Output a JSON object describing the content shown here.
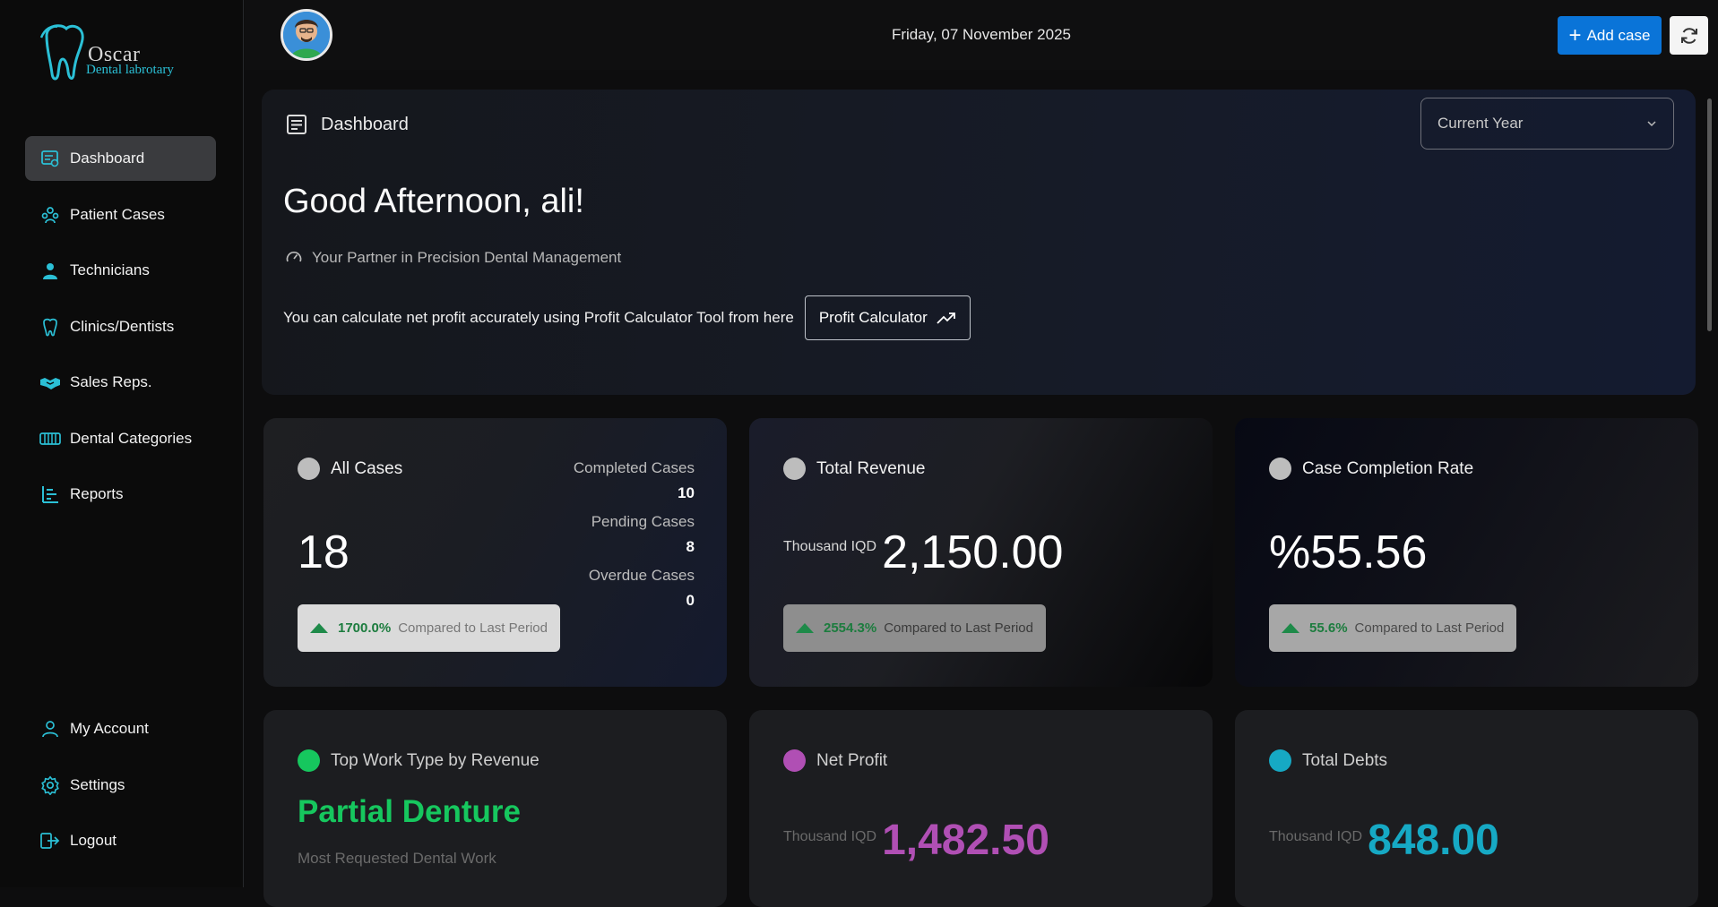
{
  "brand": {
    "name": "Oscar",
    "tagline": "Dental labrotary"
  },
  "sidebar": {
    "items": [
      {
        "label": "Dashboard",
        "icon": "dashboard-icon",
        "active": true
      },
      {
        "label": "Patient Cases",
        "icon": "patients-icon",
        "active": false
      },
      {
        "label": "Technicians",
        "icon": "technician-icon",
        "active": false
      },
      {
        "label": "Clinics/Dentists",
        "icon": "tooth-icon",
        "active": false
      },
      {
        "label": "Sales Reps.",
        "icon": "handshake-icon",
        "active": false
      },
      {
        "label": "Dental Categories",
        "icon": "categories-icon",
        "active": false
      },
      {
        "label": "Reports",
        "icon": "reports-icon",
        "active": false
      }
    ],
    "bottom_items": [
      {
        "label": "My Account",
        "icon": "user-icon"
      },
      {
        "label": "Settings",
        "icon": "gear-icon"
      },
      {
        "label": "Logout",
        "icon": "logout-icon"
      }
    ]
  },
  "header": {
    "date": "Friday, 07 November 2025",
    "add_label": "Add case"
  },
  "hero": {
    "breadcrumb": "Dashboard",
    "period_select": "Current Year",
    "greeting": "Good Afternoon, ali!",
    "tagline": "Your Partner in Precision Dental Management",
    "calc_text": "You can calculate net profit accurately using Profit Calculator Tool from here",
    "calc_button": "Profit Calculator"
  },
  "cards": {
    "all_cases": {
      "title": "All Cases",
      "value": "18",
      "change": "1700.0%",
      "compare": "Compared to Last Period",
      "completed_label": "Completed Cases",
      "completed": "10",
      "pending_label": "Pending Cases",
      "pending": "8",
      "overdue_label": "Overdue Cases",
      "overdue": "0"
    },
    "revenue": {
      "title": "Total Revenue",
      "unit": "Thousand IQD",
      "value": "2,150.00",
      "change": "2554.3%",
      "compare": "Compared to Last Period"
    },
    "completion": {
      "title": "Case Completion Rate",
      "value": "%55.56",
      "change": "55.6%",
      "compare": "Compared to Last Period"
    },
    "top_work": {
      "title": "Top Work Type by Revenue",
      "value": "Partial Denture",
      "sub": "Most Requested Dental Work"
    },
    "net_profit": {
      "title": "Net Profit",
      "unit": "Thousand IQD",
      "value": "1,482.50"
    },
    "debts": {
      "title": "Total Debts",
      "unit": "Thousand IQD",
      "value": "848.00"
    }
  },
  "colors": {
    "accent": "#0a74d8",
    "teal": "#2bc0d6",
    "green": "#16c75e",
    "purple": "#b04fb4",
    "cyan": "#16a9c4",
    "grey_dot": "#bdbdbd"
  }
}
